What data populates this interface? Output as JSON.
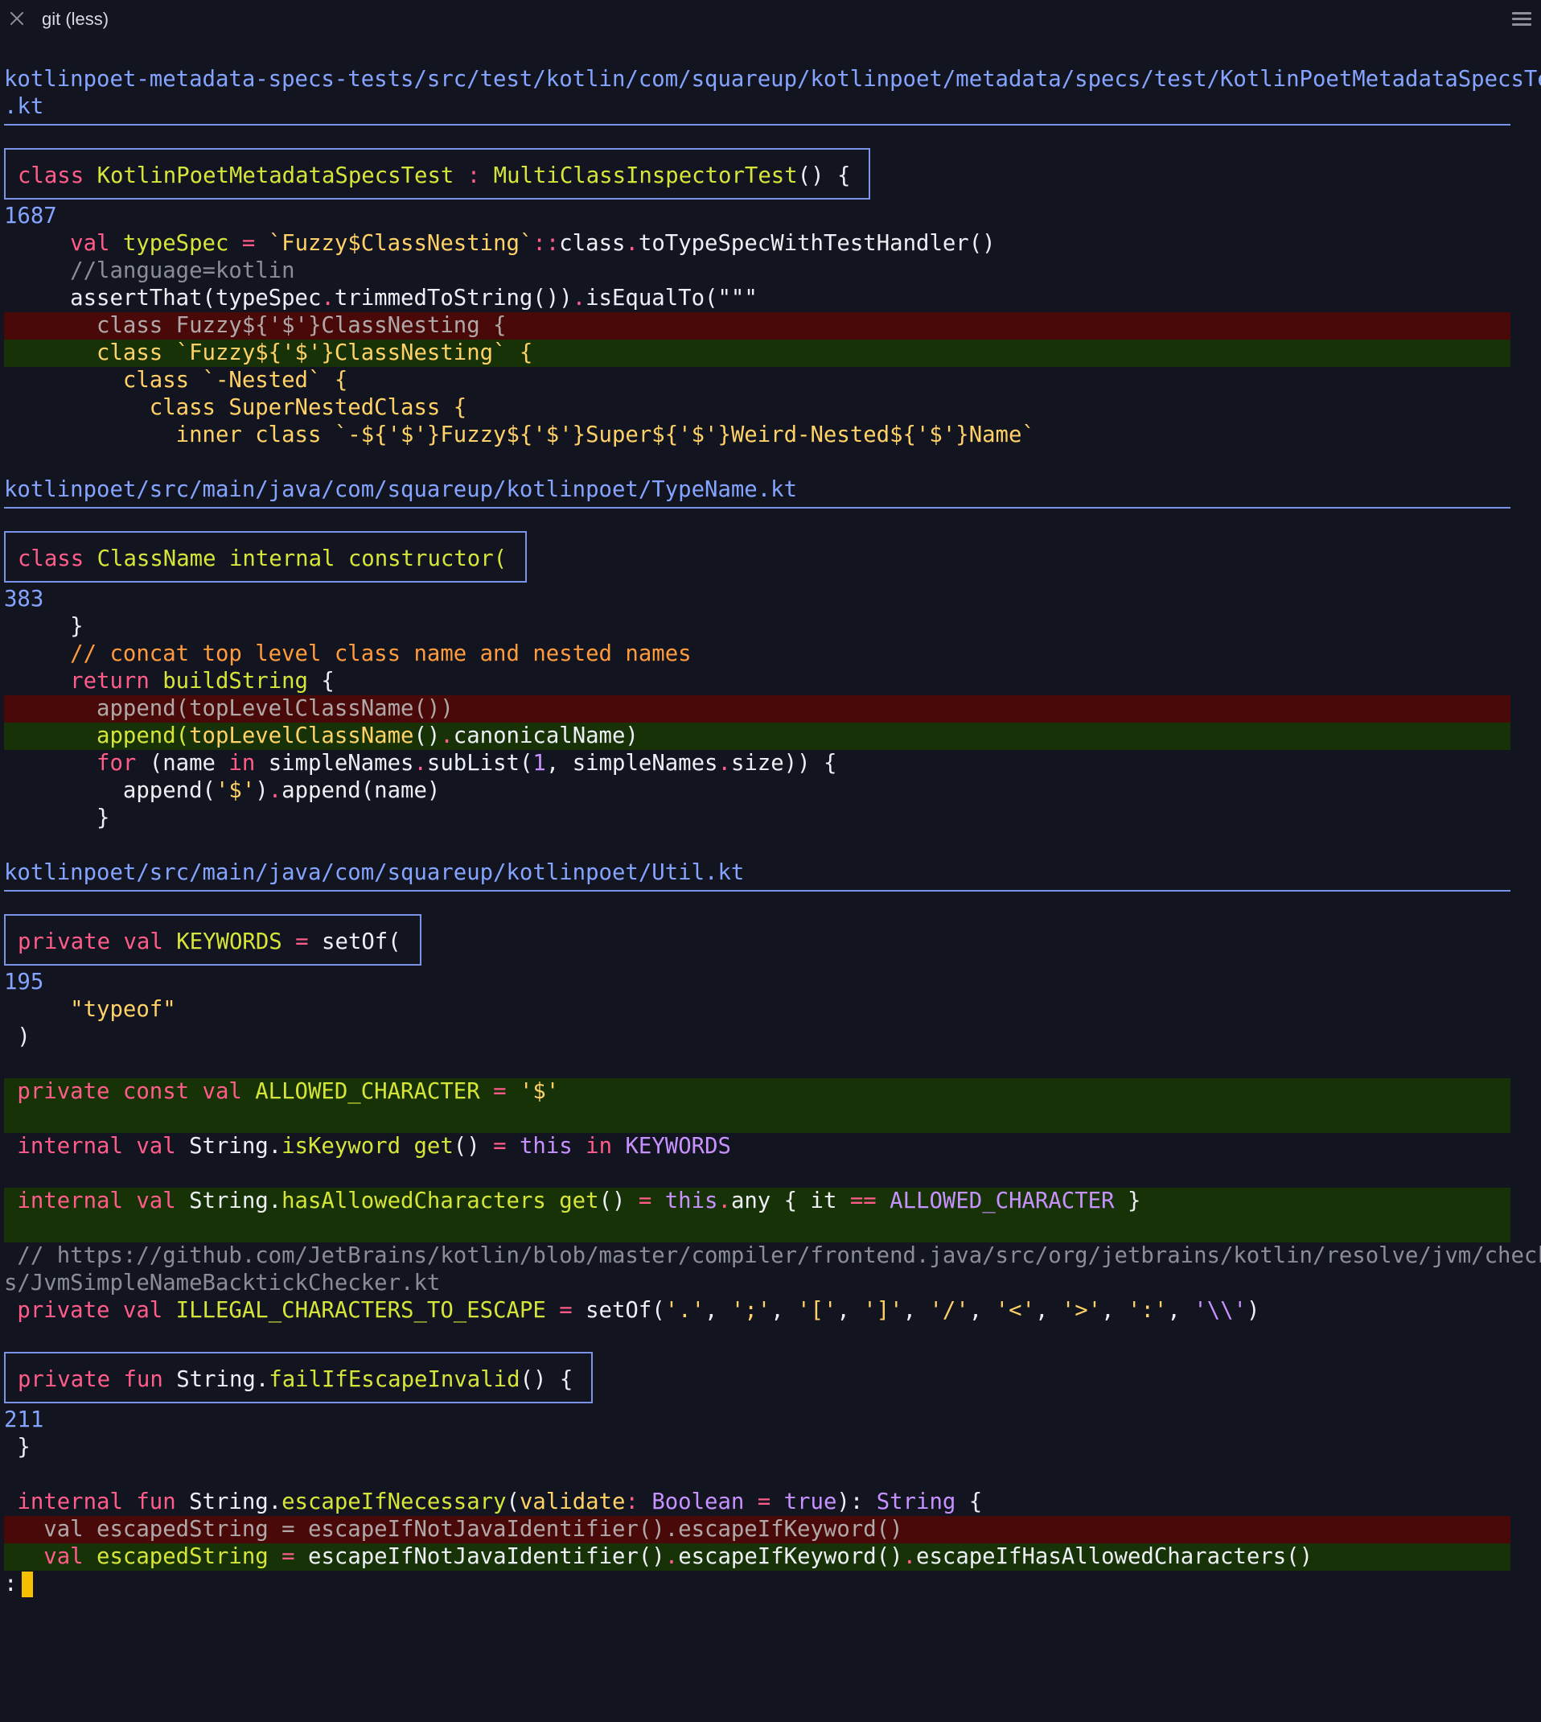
{
  "window": {
    "title": "git (less)"
  },
  "hunks": {
    "h1": {
      "file": "kotlinpoet-metadata-specs-tests/src/test/kotlin/com/squareup/kotlinpoet/metadata/specs/test/KotlinPoetMetadataSpecsTest",
      "file_wrap": ".kt",
      "ctx_kw": "class ",
      "ctx_name": "KotlinPoetMetadataSpecsTest",
      "ctx_colon": " : ",
      "ctx_super": "MultiClassInspectorTest",
      "ctx_tail": "() {",
      "line": "1687",
      "l1_indent": "     ",
      "l1_kw": "val ",
      "l1_name": "typeSpec",
      "l1_eq": " = ",
      "l1_str": "`Fuzzy$ClassNesting`",
      "l1_op": "::",
      "l1_rest1": "class",
      "l1_dot": ".",
      "l1_rest2": "toTypeSpecWithTestHandler()",
      "l2": "     //language=kotlin",
      "l3_indent": "     ",
      "l3_a": "assertThat(typeSpec",
      "l3_dot": ".",
      "l3_b": "trimmedToString())",
      "l3_dot2": ".",
      "l3_c": "isEqualTo(\"\"\"",
      "del1": "       class Fuzzy${'$'}ClassNesting {",
      "add1": "       class `Fuzzy${'$'}ClassNesting` {",
      "c1": "         class `-Nested` {",
      "c2": "           class SuperNestedClass {",
      "c3": "             inner class `-${'$'}Fuzzy${'$'}Super${'$'}Weird-Nested${'$'}Name`"
    },
    "h2": {
      "file": "kotlinpoet/src/main/java/com/squareup/kotlinpoet/TypeName.kt",
      "ctx_kw": "class ",
      "ctx_name": "ClassName",
      "ctx_rest": " internal constructor(",
      "line": "383",
      "l1": "     }",
      "l2": "     // concat top level class name and nested names",
      "l3_kw": "     return ",
      "l3_fn": "buildString",
      "l3_rest": " {",
      "del1": "       append(topLevelClassName())",
      "add1_a": "       append(",
      "add1_b": "topLevelClassName",
      "add1_c": "()",
      "add1_dot": ".",
      "add1_d": "canonicalName)",
      "l5_kw": "       for",
      "l5_a": " (name ",
      "l5_in": "in",
      "l5_b": " simpleNames",
      "l5_dot": ".",
      "l5_c": "subList(",
      "l5_n": "1",
      "l5_d": ", simpleNames",
      "l5_dot2": ".",
      "l5_e": "size)) {",
      "l6_a": "         append(",
      "l6_s": "'$'",
      "l6_b": ")",
      "l6_dot": ".",
      "l6_c": "append(name)",
      "l7": "       }"
    },
    "h3": {
      "file": "kotlinpoet/src/main/java/com/squareup/kotlinpoet/Util.kt",
      "ctx_kw": "private val ",
      "ctx_name": "KEYWORDS",
      "ctx_eq": " = ",
      "ctx_rest": "setOf(",
      "line": "195",
      "l1": "     \"typeof\"",
      "l2": " )",
      "add1_kw": " private const val ",
      "add1_name": "ALLOWED_CHARACTER",
      "add1_eq": " = ",
      "add1_s": "'$'",
      "l3_kw": " internal val ",
      "l3_a": "String.",
      "l3_fn": "isKeyword",
      "l3_get": " get",
      "l3_b": "()",
      "l3_eq": " = ",
      "l3_this": "this",
      "l3_in": " in ",
      "l3_kwds": "KEYWORDS",
      "add2_kw": " internal val ",
      "add2_a": "String.",
      "add2_fn": "hasAllowedCharacters",
      "add2_get": " get",
      "add2_b": "()",
      "add2_eq": " = ",
      "add2_this": "this",
      "add2_dot": ".",
      "add2_c": "any { it ",
      "add2_op": "==",
      "add2_ac": " ALLOWED_CHARACTER",
      "add2_d": " }",
      "cm1": " // https://github.com/JetBrains/kotlin/blob/master/compiler/frontend.java/src/org/jetbrains/kotlin/resolve/jvm/checker",
      "cm2": "s/JvmSimpleNameBacktickChecker.kt",
      "l4_kw": " private val ",
      "l4_name": "ILLEGAL_CHARACTERS_TO_ESCAPE",
      "l4_eq": " = ",
      "l4_a": "setOf(",
      "l4_s1": "'.'",
      "l4_s2": "';'",
      "l4_s3": "'['",
      "l4_s4": "']'",
      "l4_s5": "'/'",
      "l4_s6": "'<'",
      "l4_s7": "'>'",
      "l4_s8": "':'",
      "l4_s9": "'\\\\'",
      "l4_end": ")",
      "comma": ", "
    },
    "h4": {
      "ctx_kw": "private fun ",
      "ctx_a": "String.",
      "ctx_fn": "failIfEscapeInvalid",
      "ctx_rest": "() {",
      "line": "211",
      "l1": " }",
      "l2_kw": " internal fun ",
      "l2_a": "String.",
      "l2_fn": "escapeIfNecessary",
      "l2_b": "(",
      "l2_p": "validate",
      "l2_colon": ": ",
      "l2_t": "Boolean",
      "l2_eq": " = ",
      "l2_true": "true",
      "l2_c": "): ",
      "l2_t2": "String",
      "l2_d": " {",
      "del1": "   val escapedString = escapeIfNotJavaIdentifier().escapeIfKeyword()",
      "add1_kw": "   val ",
      "add1_name": "escapedString",
      "add1_eq": " = ",
      "add1_a": "escapeIfNotJavaIdentifier()",
      "add1_dot": ".",
      "add1_b": "escapeIfKeyword()",
      "add1_dot2": ".",
      "add1_c": "escapeIfHasAllowedCharacters()"
    }
  },
  "prompt": ":"
}
